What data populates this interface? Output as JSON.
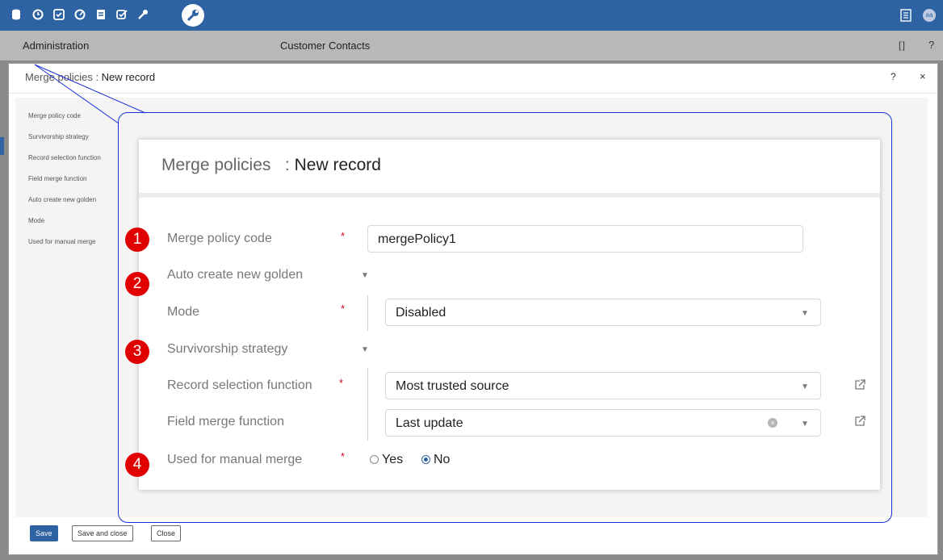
{
  "topbar": {
    "icons": [
      "database-icon",
      "clock-icon",
      "checklist-icon",
      "gauge-icon",
      "report-icon",
      "approve-icon",
      "wrench-icon",
      "admin-wrench-icon"
    ],
    "right_icons": [
      "panel-icon"
    ],
    "avatar": "aa"
  },
  "admin_bar": {
    "title": "Administration",
    "center_title": "Customer Contacts",
    "expand": "[ ]",
    "help": "?"
  },
  "bg_dialog": {
    "breadcrumb_link": "Merge policies",
    "separator": " : ",
    "record": "New record",
    "help": "?",
    "close": "×",
    "field_labels": [
      "Merge policy code",
      "Survivorship strategy",
      "Record selection function",
      "Field merge function",
      "Auto create new golden",
      "Mode",
      "Used for manual merge"
    ],
    "buttons": {
      "save": "Save",
      "save_close": "Save and close",
      "close": "Close"
    }
  },
  "zoom": {
    "title": "Merge policies",
    "separator": ":",
    "record": "New record",
    "fields": {
      "merge_policy_code": {
        "label": "Merge policy code",
        "value": "mergePolicy1",
        "required": "*"
      },
      "auto_create": {
        "label": "Auto create new golden"
      },
      "mode": {
        "label": "Mode",
        "value": "Disabled",
        "required": "*"
      },
      "survivorship": {
        "label": "Survivorship strategy"
      },
      "record_selection": {
        "label": "Record selection function",
        "value": "Most trusted source",
        "required": "*"
      },
      "field_merge": {
        "label": "Field merge function",
        "value": "Last update"
      },
      "manual_merge": {
        "label": "Used for manual merge",
        "required": "*",
        "options": [
          "Yes",
          "No"
        ],
        "selected": "No"
      }
    },
    "markers": [
      "1",
      "2",
      "3",
      "4"
    ]
  },
  "colors": {
    "topbar": "#2d63a3",
    "callout_border": "#1a2fd8",
    "marker": "#e00000",
    "required": "#d0021b"
  }
}
